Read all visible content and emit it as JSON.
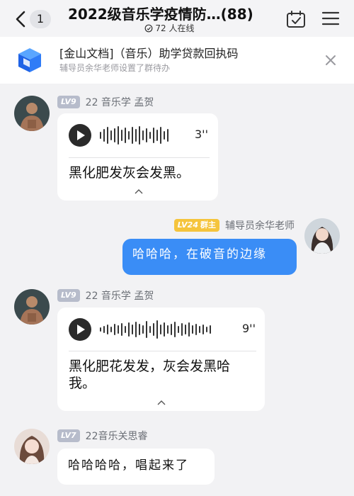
{
  "header": {
    "back_count": "1",
    "title": "2022级音乐学疫情防…(88)",
    "online": "72 人在线"
  },
  "notice": {
    "title": "[金山文档]（音乐）助学贷款回执码",
    "subtitle": "辅导员余华老师设置了群待办"
  },
  "messages": [
    {
      "level": "LV9",
      "name": "22 音乐学 孟贺",
      "type": "voice",
      "duration": "3''",
      "transcript": "黑化肥发灰会发黑。"
    },
    {
      "level": "LV24",
      "role": "群主",
      "name": "辅导员余华老师",
      "type": "text",
      "text": "哈哈哈，在破音的边缘"
    },
    {
      "level": "LV9",
      "name": "22 音乐学 孟贺",
      "type": "voice",
      "duration": "9''",
      "transcript_line1": "黑化肥花发发，灰会发黑哈",
      "transcript_line2": "我。"
    },
    {
      "level": "LV7",
      "name": "22音乐关思睿",
      "type": "text",
      "text": "哈哈哈哈，唱起来了"
    }
  ],
  "colors": {
    "accent_blue": "#3a8df6",
    "level_badge": "#b7bccb",
    "owner_badge": "#f5c43c",
    "background": "#f2f2f4"
  },
  "icons": [
    "back-arrow-icon",
    "clock-icon",
    "calendar-check-icon",
    "menu-icon",
    "kdocs-logo-icon",
    "close-icon",
    "play-icon",
    "chevron-up-icon"
  ]
}
